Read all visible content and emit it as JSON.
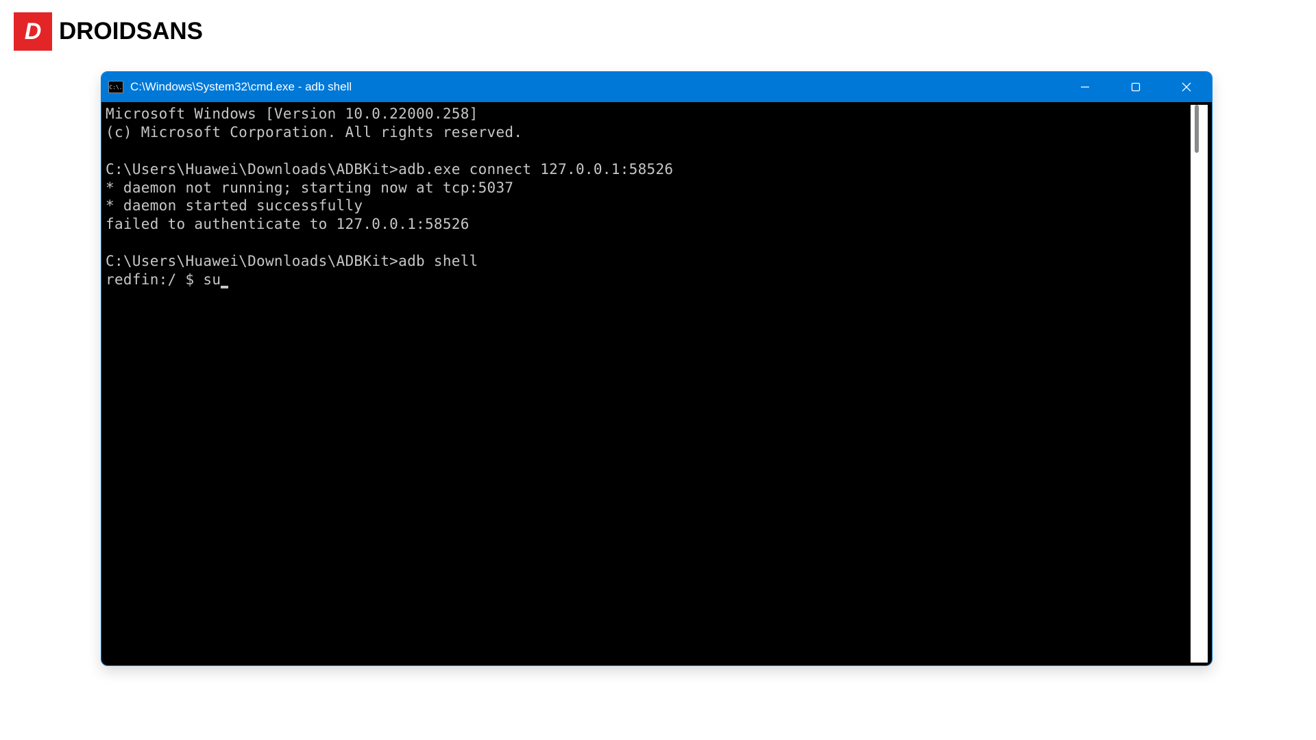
{
  "logo": {
    "icon_text": "D",
    "brand_text": "DROIDSANS"
  },
  "window": {
    "title": "C:\\Windows\\System32\\cmd.exe - adb  shell",
    "icon_label": "C:\\."
  },
  "terminal": {
    "lines": [
      "Microsoft Windows [Version 10.0.22000.258]",
      "(c) Microsoft Corporation. All rights reserved.",
      "",
      "C:\\Users\\Huawei\\Downloads\\ADBKit>adb.exe connect 127.0.0.1:58526",
      "* daemon not running; starting now at tcp:5037",
      "* daemon started successfully",
      "failed to authenticate to 127.0.0.1:58526",
      "",
      "C:\\Users\\Huawei\\Downloads\\ADBKit>adb shell",
      "redfin:/ $ su"
    ]
  }
}
